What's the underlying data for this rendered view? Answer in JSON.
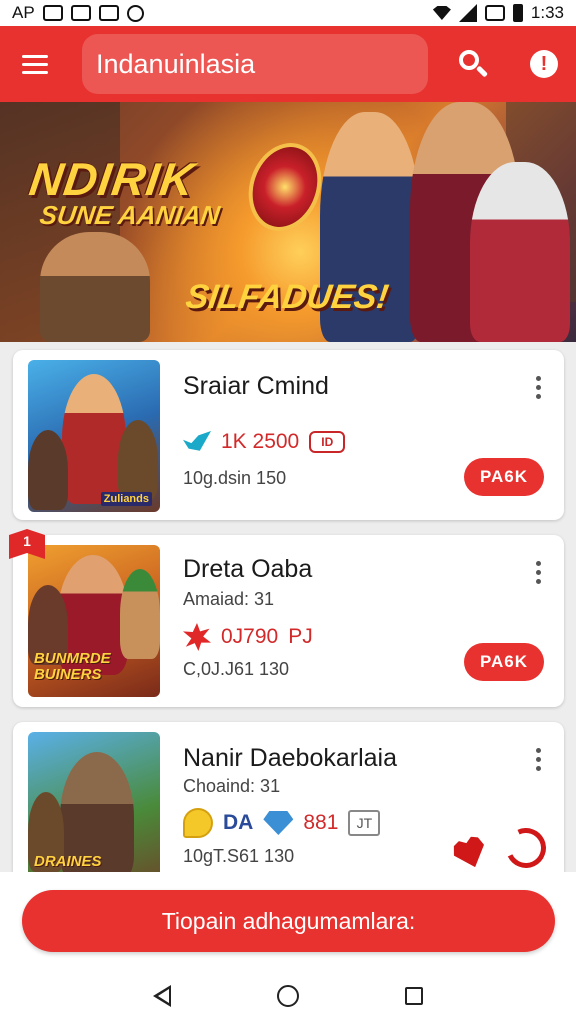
{
  "status_bar": {
    "carrier": "AP",
    "time": "1:33",
    "icons": [
      "notification-icon",
      "image-icon",
      "shield-icon",
      "circle-icon",
      "wifi-icon",
      "signal-icon",
      "bluetooth-icon",
      "battery-icon"
    ]
  },
  "app_bar": {
    "search_text": "Indanuinlasia",
    "icons": [
      "menu-icon",
      "search-icon",
      "alert-icon"
    ],
    "alert_glyph": "!",
    "color": "#e8322f"
  },
  "banner": {
    "title_line1": "NDIRIK",
    "title_line2": "SUNE AANIAN",
    "title_line3": "SILFADUES!"
  },
  "cards": [
    {
      "title": "Sraiar Cmind",
      "subtitle": "",
      "stat_value": "1K 2500",
      "stat_badge": "ID",
      "meta": "10g.dsin 150",
      "button": "PA6K",
      "thumb_label": "Zuliands",
      "icons": [
        "bird-icon",
        "badge-icon"
      ]
    },
    {
      "title": "Dreta Oaba",
      "subtitle": "Amaiad: 31",
      "stat_value": "0J790",
      "stat_extra": "PJ",
      "meta": "C,0J.J61 130",
      "button": "PA6K",
      "ribbon": "1",
      "thumb_label": "BUNMRDE BUINERS",
      "icons": [
        "burst-icon",
        "ribbon-icon"
      ]
    },
    {
      "title": "Nanir Daebokarlaia",
      "subtitle": "Choaind: 31",
      "stat_value": "DA",
      "stat_extra": "881",
      "stat_badge": "JT",
      "meta": "10gT.S61 130",
      "thumb_label": "DRAINES",
      "icons": [
        "bubble-icon",
        "gem-icon",
        "book-icon",
        "heart-icon",
        "undo-icon"
      ]
    }
  ],
  "cta": {
    "label": "Tiopain adhagumamlara:"
  },
  "nav": {
    "icons": [
      "back-icon",
      "home-icon",
      "recents-icon"
    ]
  }
}
